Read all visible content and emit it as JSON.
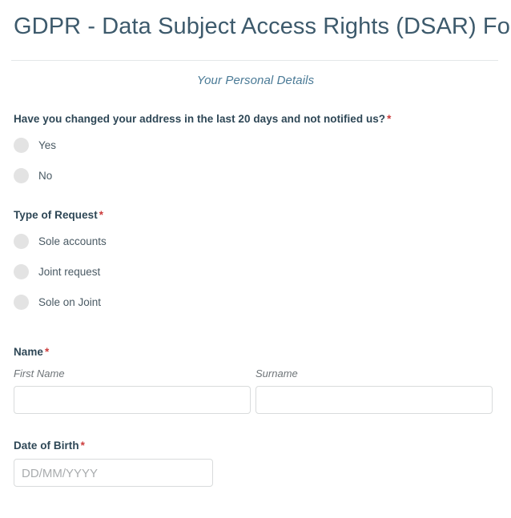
{
  "header": {
    "title": "GDPR - Data Subject Access Rights (DSAR) Form",
    "subtitle": "Your Personal Details",
    "title_color": "#3d5a6c",
    "subtitle_color": "#4a7a96",
    "divider_color": "#e4e7e9"
  },
  "required_marker": "*",
  "required_marker_color": "#cc3c3c",
  "fields": {
    "address_changed": {
      "label": "Have you changed your address in the last 20 days and not notified us?",
      "required": true,
      "type": "radio",
      "options": [
        {
          "label": "Yes",
          "selected": false
        },
        {
          "label": "No",
          "selected": false
        }
      ]
    },
    "request_type": {
      "label": "Type of Request",
      "required": true,
      "type": "radio",
      "options": [
        {
          "label": "Sole accounts",
          "selected": false
        },
        {
          "label": "Joint request",
          "selected": false
        },
        {
          "label": "Sole on Joint",
          "selected": false
        }
      ]
    },
    "name": {
      "label": "Name",
      "required": true,
      "type": "text-pair",
      "first_name": {
        "sub_label": "First Name",
        "value": "",
        "placeholder": ""
      },
      "surname": {
        "sub_label": "Surname",
        "value": "",
        "placeholder": ""
      }
    },
    "date_of_birth": {
      "label": "Date of Birth",
      "required": true,
      "type": "text",
      "value": "",
      "placeholder": "DD/MM/YYYY"
    }
  },
  "styles": {
    "radio_fill": "#e3e3e3",
    "input_border": "#d9dbdc",
    "label_color": "#2e4756",
    "option_label_color": "#4a5a64",
    "placeholder_color": "#a9acae"
  }
}
